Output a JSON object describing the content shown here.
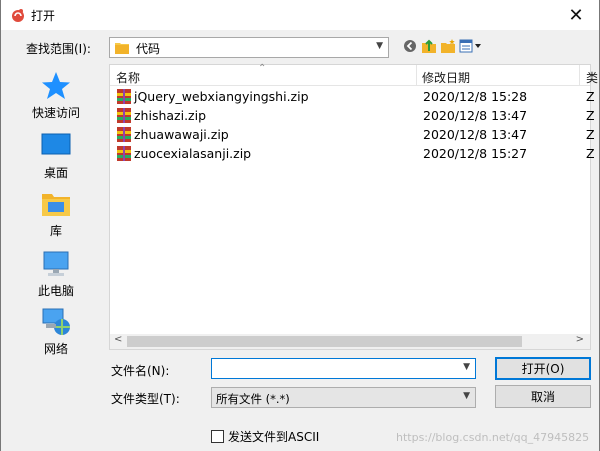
{
  "window": {
    "title": "打开",
    "close_glyph": "✕",
    "app_icon": "app-swirl-icon"
  },
  "lookin": {
    "label": "查找范围(I):",
    "value": "代码",
    "arrow": "⌵"
  },
  "toolbar": {
    "back_icon": "back-icon",
    "up_icon": "up-folder-icon",
    "newfolder_icon": "new-folder-icon",
    "views_icon": "view-menu-icon"
  },
  "places": [
    {
      "label": "快速访问",
      "icon": "quick-access-star-icon"
    },
    {
      "label": "桌面",
      "icon": "desktop-icon"
    },
    {
      "label": "库",
      "icon": "library-folder-icon"
    },
    {
      "label": "此电脑",
      "icon": "computer-icon"
    },
    {
      "label": "网络",
      "icon": "network-icon"
    }
  ],
  "files": {
    "headers": {
      "name": "名称",
      "date": "修改日期",
      "type": "类"
    },
    "rows": [
      {
        "name": "jQuery_webxiangyingshi.zip",
        "date": "2020/12/8 15:28",
        "type": "Z"
      },
      {
        "name": "zhishazi.zip",
        "date": "2020/12/8 13:47",
        "type": "Z"
      },
      {
        "name": "zhuawawaji.zip",
        "date": "2020/12/8 13:47",
        "type": "Z"
      },
      {
        "name": "zuocexialasanji.zip",
        "date": "2020/12/8 15:27",
        "type": "Z"
      }
    ],
    "scroll_left": "<",
    "scroll_right": ">"
  },
  "filename": {
    "label": "文件名(N):",
    "value": ""
  },
  "filetype": {
    "label": "文件类型(T):",
    "value": "所有文件 (*.*)"
  },
  "buttons": {
    "open": "打开(O)",
    "cancel": "取消"
  },
  "ascii": {
    "label": "发送文件到ASCII",
    "checked": false
  },
  "watermark": "https://blog.csdn.net/qq_47945825",
  "colors": {
    "accent": "#0078d7",
    "folder": "#f7c948",
    "zip": "#c0392b"
  }
}
